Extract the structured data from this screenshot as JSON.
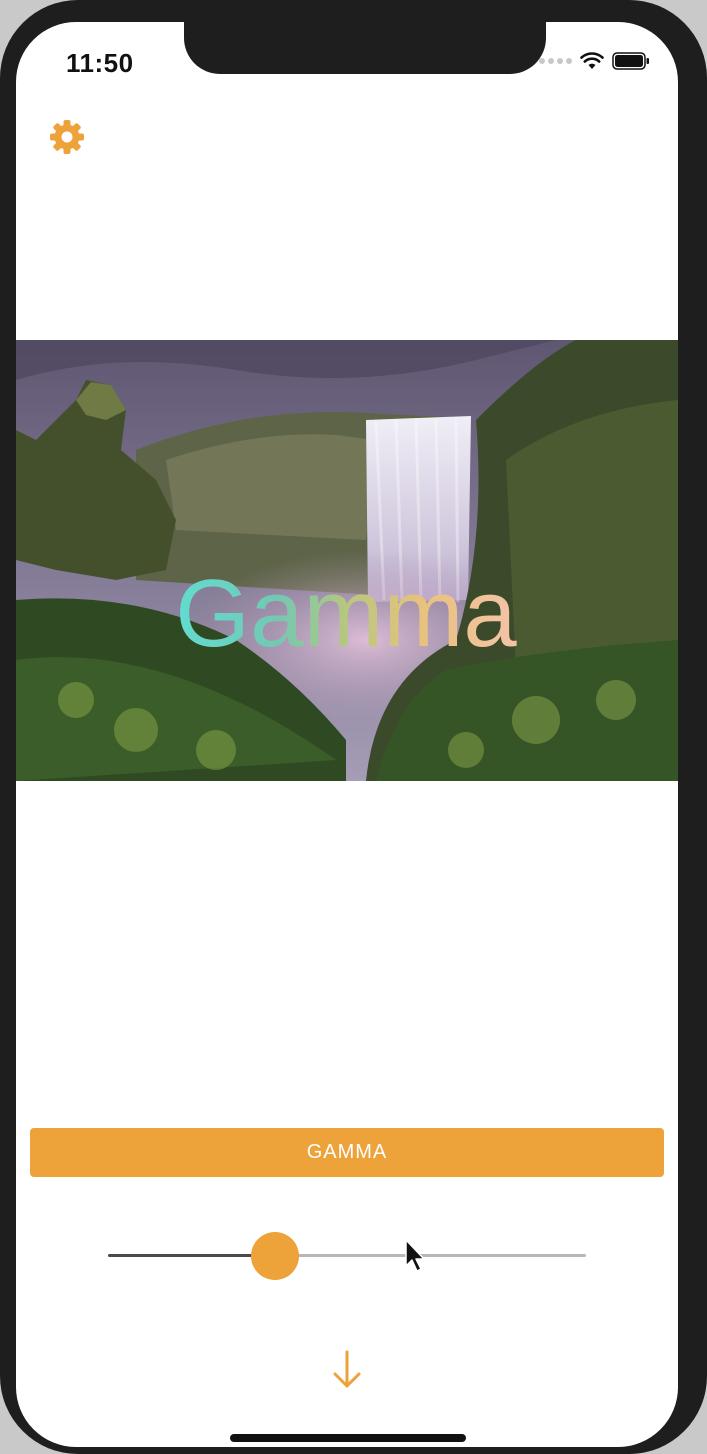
{
  "status_bar": {
    "time": "11:50"
  },
  "toolbar": {
    "settings_icon": "gear-icon"
  },
  "image": {
    "subject": "waterfall",
    "overlay_text": "Gamma"
  },
  "controls": {
    "filter_button_label": "GAMMA",
    "slider_value_fraction": 0.35,
    "download_icon": "arrow-down-icon"
  },
  "colors": {
    "accent": "#eea23a",
    "device_frame": "#1e1e1e"
  }
}
